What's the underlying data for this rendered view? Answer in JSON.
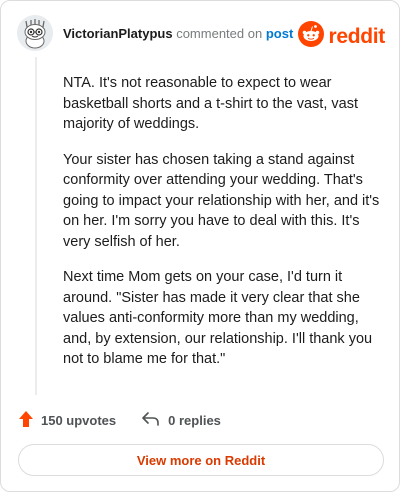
{
  "header": {
    "username": "VictorianPlatypus",
    "action": "commented on",
    "post_link": "post",
    "logo_text": "reddit"
  },
  "comment": {
    "paragraphs": [
      "NTA. It's not reasonable to expect to wear basketball shorts and a t-shirt to the vast, vast majority of weddings.",
      "Your sister has chosen taking a stand against conformity over attending your wedding. That's going to impact your relationship with her, and it's on her. I'm sorry you have to deal with this. It's very selfish of her.",
      "Next time Mom gets on your case, I'd turn it around. \"Sister has made it very clear that she values anti-conformity more than my wedding, and, by extension, our relationship. I'll thank you not to blame me for that.\""
    ]
  },
  "footer": {
    "upvotes": "150 upvotes",
    "replies": "0 replies",
    "view_more": "View more on Reddit"
  },
  "colors": {
    "brand": "#ff4500",
    "link": "#0079d3",
    "button_text": "#d93a00"
  },
  "icons": {
    "avatar": "snoo-avatar-icon",
    "logo": "reddit-snoo-icon",
    "upvote": "upvote-arrow-icon",
    "reply": "reply-arrow-icon"
  }
}
